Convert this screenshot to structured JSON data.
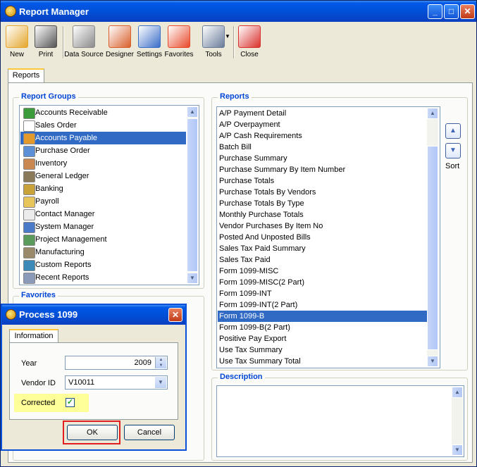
{
  "window": {
    "title": "Report Manager"
  },
  "window_controls": {
    "minimize": "_",
    "maximize": "□",
    "close": "✕"
  },
  "toolbar": [
    {
      "key": "new",
      "label": "New",
      "icon": "new-report-icon",
      "color": "#e4a62b"
    },
    {
      "key": "print",
      "label": "Print",
      "icon": "printer-icon",
      "color": "#555555"
    },
    {
      "key": "data_source",
      "label": "Data Source",
      "icon": "database-icon",
      "color": "#8a8a8a"
    },
    {
      "key": "designer",
      "label": "Designer",
      "icon": "designer-icon",
      "color": "#d9602c"
    },
    {
      "key": "settings",
      "label": "Settings",
      "icon": "settings-panel-icon",
      "color": "#3a6ec8"
    },
    {
      "key": "favorites",
      "label": "Favorites",
      "icon": "favorites-chart-icon",
      "color": "#e8492a"
    },
    {
      "key": "tools",
      "label": "Tools",
      "icon": "tools-icon",
      "color": "#6a7c99"
    },
    {
      "key": "close",
      "label": "Close",
      "icon": "close-report-icon",
      "color": "#d9302c"
    }
  ],
  "tools_dropdown_arrow": "▼",
  "tabs": {
    "reports": "Reports"
  },
  "report_groups": {
    "title": "Report Groups",
    "items": [
      {
        "label": "Accounts Receivable",
        "color": "#3c9c3c"
      },
      {
        "label": "Sales Order",
        "color": "#ffffff"
      },
      {
        "label": "Accounts Payable",
        "color": "#e39a2a"
      },
      {
        "label": "Purchase Order",
        "color": "#5b8fd6"
      },
      {
        "label": "Inventory",
        "color": "#c88850"
      },
      {
        "label": "General Ledger",
        "color": "#8a7a5a"
      },
      {
        "label": "Banking",
        "color": "#c9a33a"
      },
      {
        "label": "Payroll",
        "color": "#e8c55a"
      },
      {
        "label": "Contact Manager",
        "color": "#ececec"
      },
      {
        "label": "System Manager",
        "color": "#4a7ac8"
      },
      {
        "label": "Project Management",
        "color": "#5a9a5a"
      },
      {
        "label": "Manufacturing",
        "color": "#9a8a6a"
      },
      {
        "label": "Custom Reports",
        "color": "#3c8ab8"
      },
      {
        "label": "Recent Reports",
        "color": "#8a9ab8"
      }
    ],
    "selected": 2
  },
  "favorites": {
    "title": "Favorites"
  },
  "reports": {
    "title": "Reports",
    "items": [
      "A/P Payment Detail",
      "A/P Overpayment",
      "A/P Cash Requirements",
      "Batch Bill",
      "Purchase Summary",
      "Purchase Summary By Item Number",
      "Purchase Totals",
      "Purchase Totals By Vendors",
      "Purchase Totals By Type",
      "Monthly Purchase Totals",
      "Vendor Purchases By Item No",
      "Posted And Unposted Bills",
      "Sales Tax Paid Summary",
      "Sales Tax Paid",
      "Form 1099-MISC",
      "Form 1099-MISC(2 Part)",
      "Form 1099-INT",
      "Form 1099-INT(2 Part)",
      "Form 1099-B",
      "Form 1099-B(2 Part)",
      "Positive Pay Export",
      "Use Tax Summary",
      "Use Tax Summary Total"
    ],
    "selected": 18
  },
  "sort": {
    "label": "Sort",
    "up": "▲",
    "down": "▼"
  },
  "description": {
    "title": "Description"
  },
  "scroll_arrows": {
    "up": "▲",
    "down": "▼"
  },
  "dialog": {
    "title": "Process 1099",
    "close": "✕",
    "tab": "Information",
    "year_label": "Year",
    "year_value": "2009",
    "vendor_label": "Vendor ID",
    "vendor_value": "V10011",
    "corrected_label": "Corrected",
    "corrected": true,
    "check_mark": "✓",
    "ok_label": "OK",
    "cancel_label": "Cancel",
    "highlight_color": "#ffff99",
    "focus_outline_color": "#e02020"
  }
}
